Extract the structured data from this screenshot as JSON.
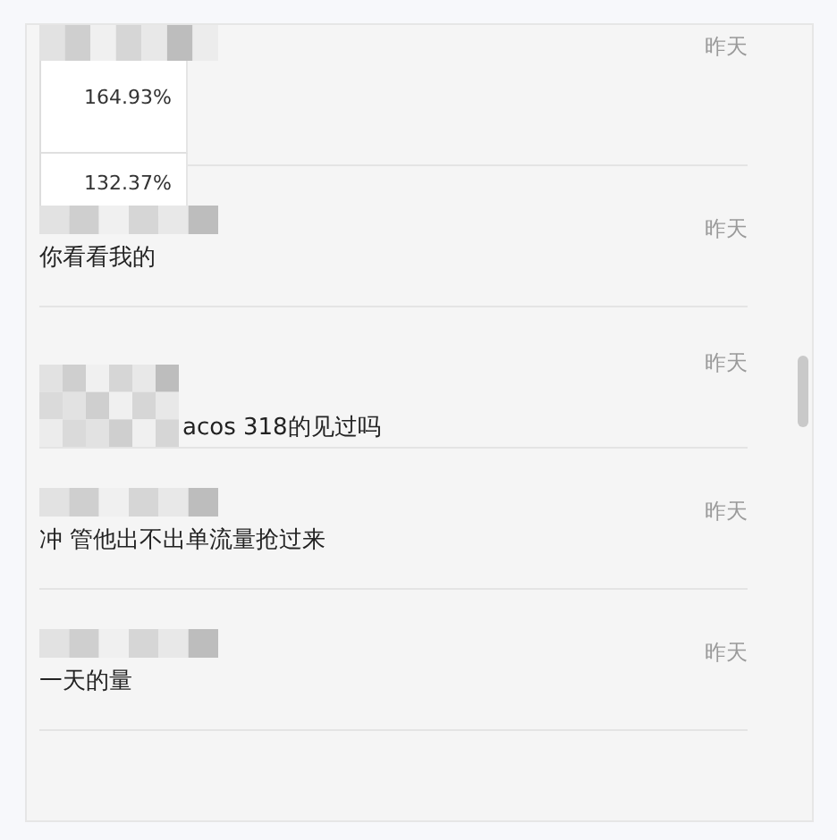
{
  "messages": [
    {
      "kind": "table",
      "time": "昨天",
      "cells": [
        "164.93%",
        "132.37%"
      ]
    },
    {
      "kind": "text",
      "time": "昨天",
      "text": "你看看我的"
    },
    {
      "kind": "inline",
      "time": "昨天",
      "text": "acos 318的见过吗"
    },
    {
      "kind": "text",
      "time": "昨天",
      "text": "冲 管他出不出单流量抢过来"
    },
    {
      "kind": "text",
      "time": "昨天",
      "text": "一天的量"
    }
  ]
}
